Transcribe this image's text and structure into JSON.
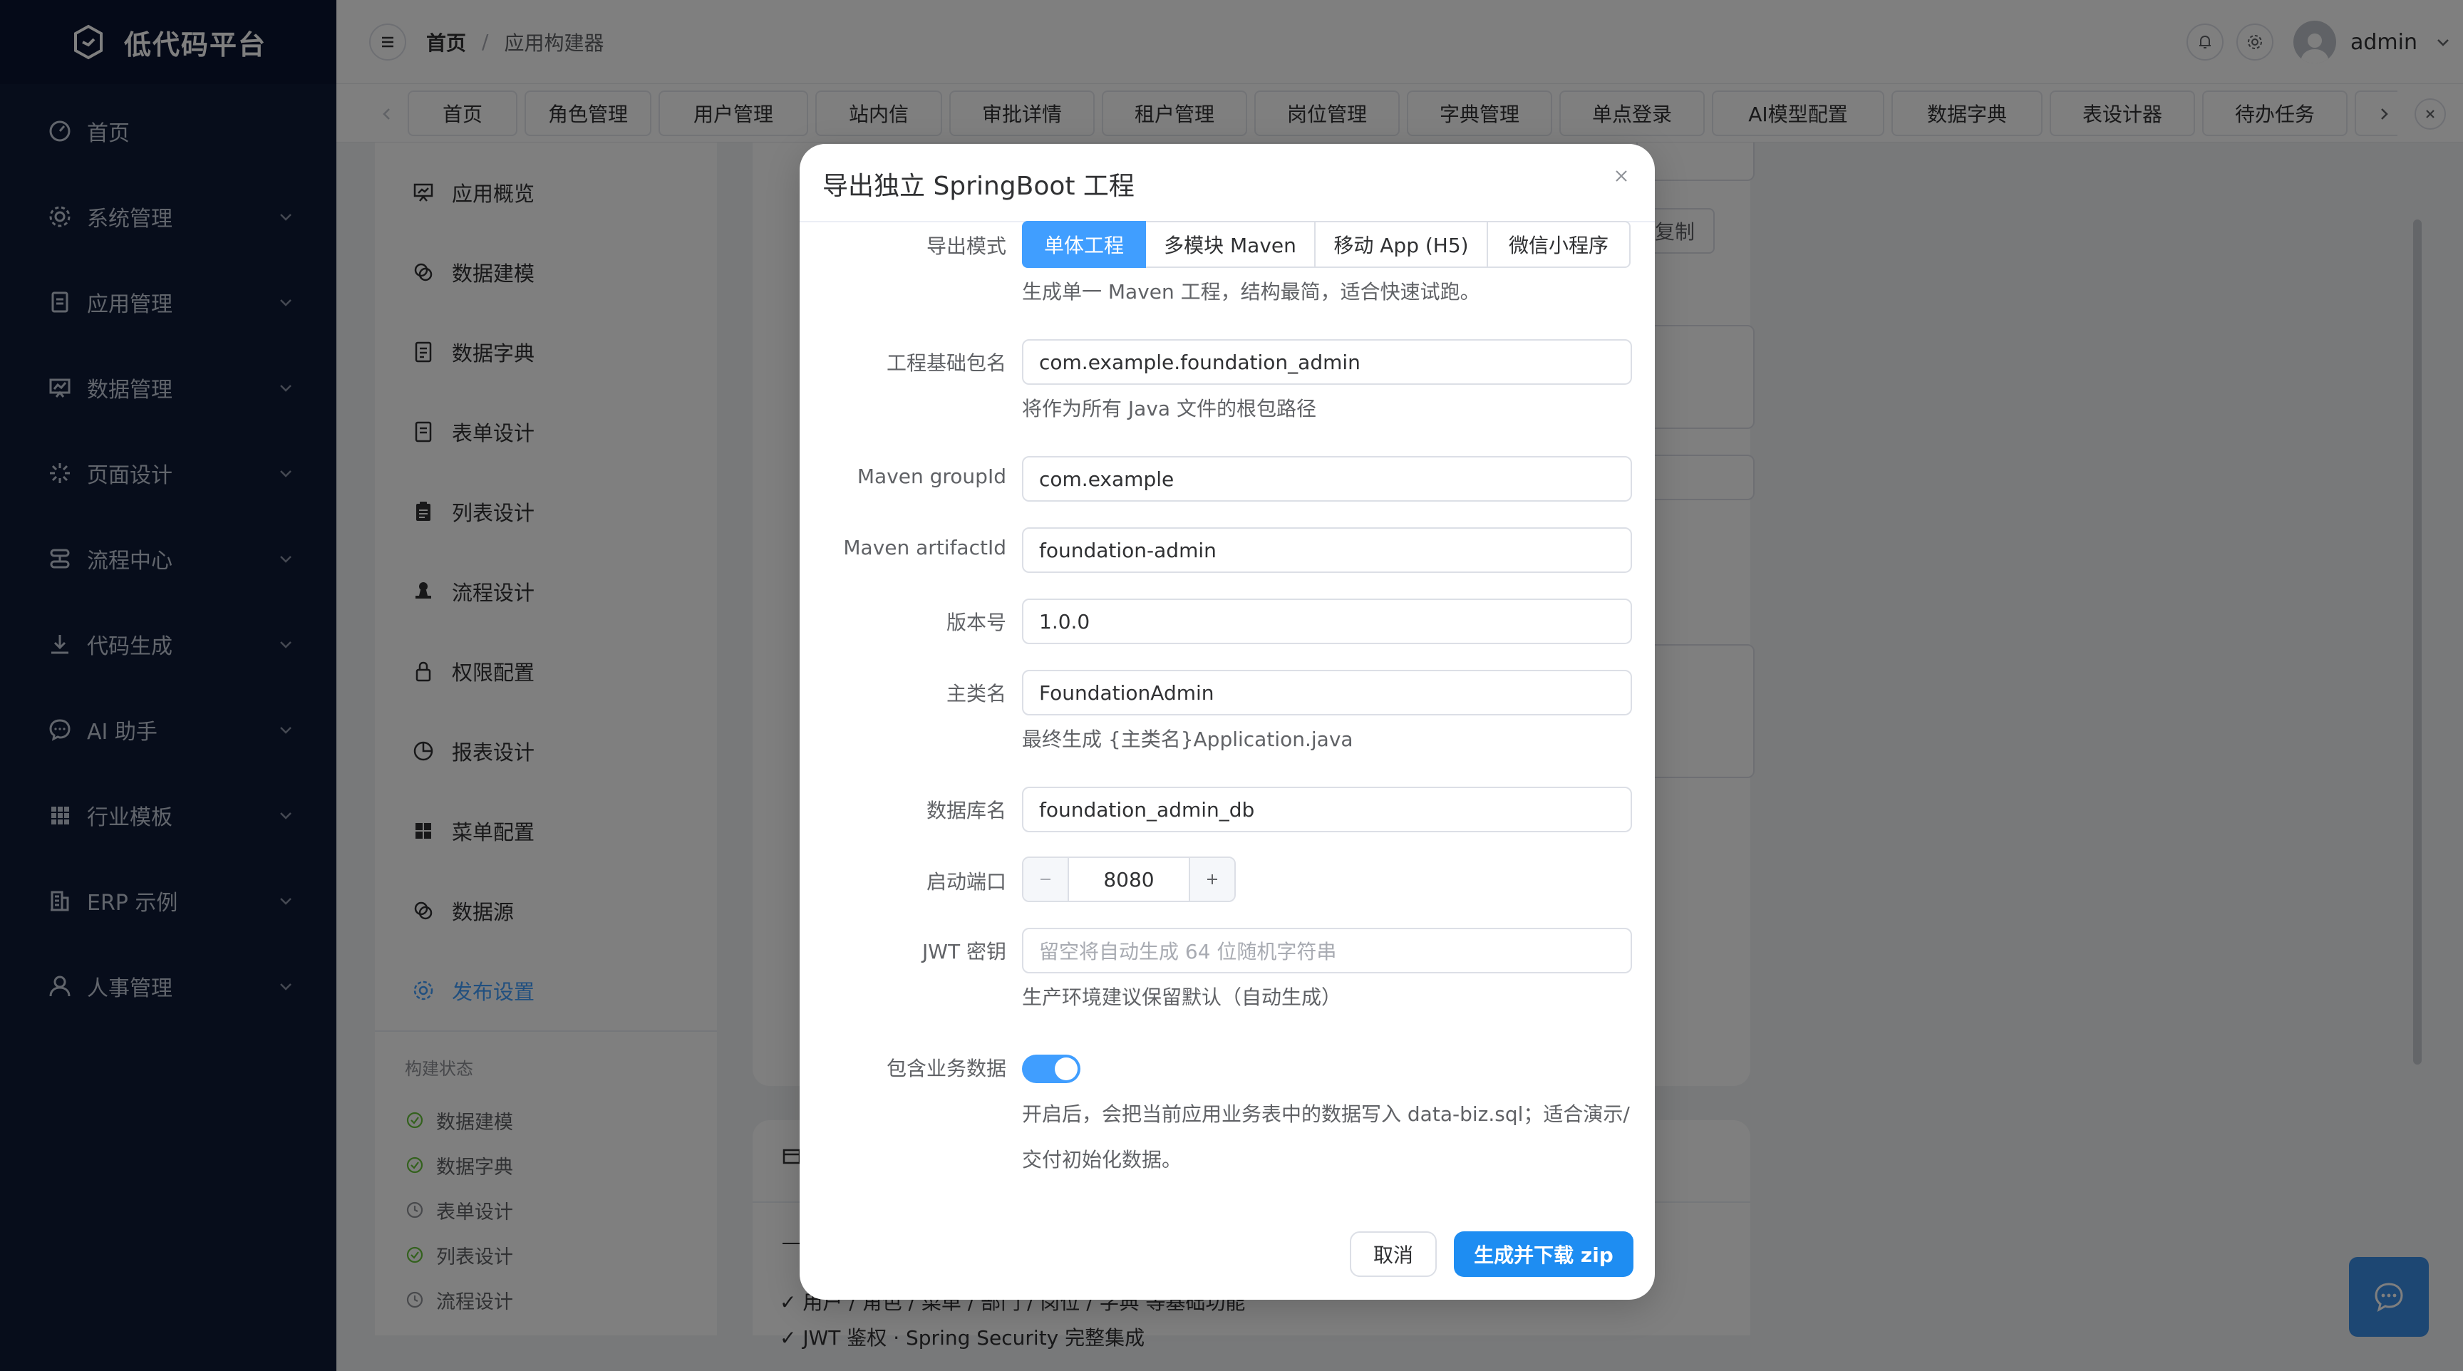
{
  "app": {
    "title": "低代码平台"
  },
  "sidebar": {
    "items": [
      {
        "label": "首页",
        "icon": "dashboard-icon"
      },
      {
        "label": "系统管理",
        "icon": "gear-icon"
      },
      {
        "label": "应用管理",
        "icon": "document-icon"
      },
      {
        "label": "数据管理",
        "icon": "chart-board-icon"
      },
      {
        "label": "页面设计",
        "icon": "loading-icon"
      },
      {
        "label": "流程中心",
        "icon": "workflow-icon"
      },
      {
        "label": "代码生成",
        "icon": "download-icon"
      },
      {
        "label": "AI 助手",
        "icon": "chat-icon"
      },
      {
        "label": "行业模板",
        "icon": "grid-icon"
      },
      {
        "label": "ERP 示例",
        "icon": "building-icon"
      },
      {
        "label": "人事管理",
        "icon": "user-icon"
      }
    ]
  },
  "header": {
    "breadcrumb": {
      "home": "首页",
      "separator": "/",
      "current": "应用构建器"
    },
    "username": "admin"
  },
  "tabs": [
    "首页",
    "角色管理",
    "用户管理",
    "站内信",
    "审批详情",
    "租户管理",
    "岗位管理",
    "字典管理",
    "单点登录",
    "AI模型配置",
    "数据字典",
    "表设计器",
    "待办任务"
  ],
  "subnav": {
    "items": [
      {
        "label": "应用概览",
        "icon": "overview-icon"
      },
      {
        "label": "数据建模",
        "icon": "model-icon"
      },
      {
        "label": "数据字典",
        "icon": "dictionary-icon"
      },
      {
        "label": "表单设计",
        "icon": "form-icon"
      },
      {
        "label": "列表设计",
        "icon": "list-icon"
      },
      {
        "label": "流程设计",
        "icon": "stamp-icon"
      },
      {
        "label": "权限配置",
        "icon": "lock-icon"
      },
      {
        "label": "报表设计",
        "icon": "pie-chart-icon"
      },
      {
        "label": "菜单配置",
        "icon": "menu-grid-icon"
      },
      {
        "label": "数据源",
        "icon": "datasource-icon"
      },
      {
        "label": "发布设置",
        "icon": "gear-icon",
        "active": true
      }
    ],
    "build_status_title": "构建状态",
    "build_items": [
      {
        "label": "数据建模",
        "status": "done"
      },
      {
        "label": "数据字典",
        "status": "done"
      },
      {
        "label": "表单设计",
        "status": "pending"
      },
      {
        "label": "列表设计",
        "status": "done"
      },
      {
        "label": "流程设计",
        "status": "pending"
      }
    ]
  },
  "background": {
    "copy_label": "复制",
    "lower_line1": "✓ 用户 / 角色 / 菜单 / 部门 / 岗位 / 字典 等基础功能",
    "lower_line2": "✓ JWT 鉴权 · Spring Security 完整集成"
  },
  "dialog": {
    "title": "导出独立 SpringBoot 工程",
    "export_mode": {
      "label": "导出模式",
      "options": [
        "单体工程",
        "多模块 Maven",
        "移动 App (H5)",
        "微信小程序"
      ],
      "selected": "单体工程",
      "help": "生成单一 Maven 工程，结构最简，适合快速试跑。"
    },
    "base_package": {
      "label": "工程基础包名",
      "value": "com.example.foundation_admin",
      "help": "将作为所有 Java 文件的根包路径"
    },
    "group_id": {
      "label": "Maven groupId",
      "value": "com.example"
    },
    "artifact_id": {
      "label": "Maven artifactId",
      "value": "foundation-admin"
    },
    "version": {
      "label": "版本号",
      "value": "1.0.0"
    },
    "main_class": {
      "label": "主类名",
      "value": "FoundationAdmin",
      "help": "最终生成 {主类名}Application.java"
    },
    "db_name": {
      "label": "数据库名",
      "value": "foundation_admin_db"
    },
    "port": {
      "label": "启动端口",
      "value": "8080"
    },
    "jwt_secret": {
      "label": "JWT 密钥",
      "value": "",
      "placeholder": "留空将自动生成 64 位随机字符串",
      "help": "生产环境建议保留默认（自动生成）"
    },
    "include_biz_data": {
      "label": "包含业务数据",
      "enabled": true,
      "help_line1": "开启后，会把当前应用业务表中的数据写入 data-biz.sql；适合演示/",
      "help_line2": "交付初始化数据。"
    },
    "cancel_label": "取消",
    "submit_label": "生成并下载 zip"
  },
  "colors": {
    "sidebar_bg": "#0f1a36",
    "primary": "#409eff",
    "submit_button": "#1e8df2",
    "overlay": "rgba(0,0,0,0.5)"
  }
}
